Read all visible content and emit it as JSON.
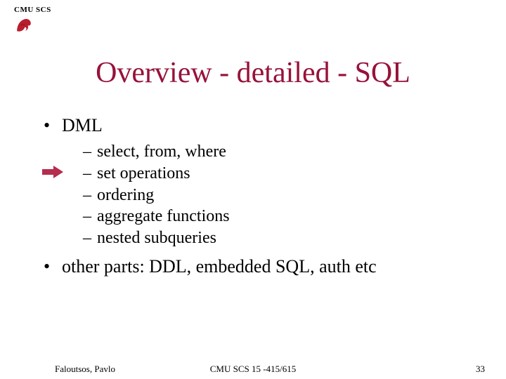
{
  "header": {
    "label": "CMU SCS"
  },
  "title": "Overview - detailed - SQL",
  "bullets": {
    "b1": "DML",
    "b2": "other parts: DDL, embedded SQL, auth etc"
  },
  "sub_items": {
    "s1": "select, from, where",
    "s2": "set operations",
    "s3": "ordering",
    "s4": "aggregate functions",
    "s5": "nested subqueries"
  },
  "footer": {
    "left": "Faloutsos, Pavlo",
    "center": "CMU SCS 15 -415/615",
    "right": "33"
  },
  "colors": {
    "title": "#97123a",
    "arrow": "#b52c4e"
  }
}
